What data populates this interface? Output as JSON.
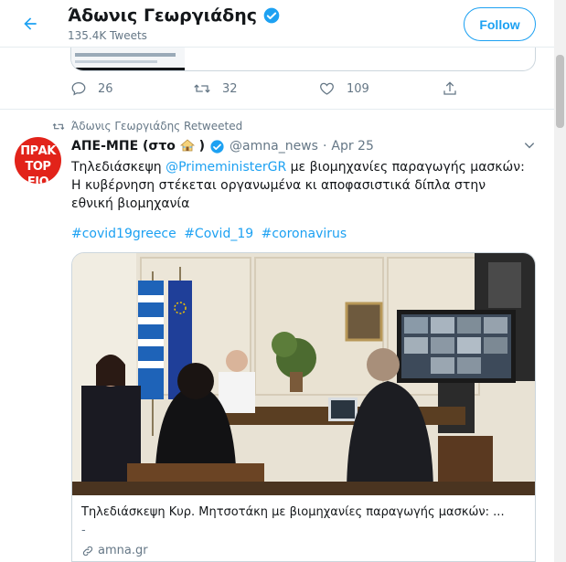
{
  "header": {
    "title": "Άδωνις Γεωργιάδης",
    "tweets_count": "135.4K Tweets",
    "follow_label": "Follow"
  },
  "previous_tweet": {
    "replies": "26",
    "retweets": "32",
    "likes": "109"
  },
  "tweet": {
    "retweeted_by": "Άδωνις Γεωργιάδης Retweeted",
    "avatar_text": "ΠΡΑΚΤΟΡΕΙΟ",
    "name_prefix": "ΑΠΕ-ΜΠΕ (στο",
    "name_suffix": ")",
    "handle": "@amna_news",
    "separator": "·",
    "date": "Apr 25",
    "text_before": "Τηλεδιάσκεψη ",
    "mention": "@PrimeministerGR",
    "text_after": " με βιομηχανίες παραγωγής μασκών: Η κυβέρνηση στέκεται οργανωμένα κι αποφασιστικά δίπλα στην εθνική βιομηχανία",
    "hashtags": [
      "#covid19greece",
      "#Covid_19",
      "#coronavirus"
    ]
  },
  "link_card": {
    "title": "Τηλεδιάσκεψη Κυρ. Μητσοτάκη με βιομηχανίες παραγωγής μασκών: ...",
    "description": "-",
    "domain": "amna.gr"
  },
  "colors": {
    "accent": "#1da1f2",
    "text": "#14171a",
    "muted": "#657786",
    "border": "#e6ecf0",
    "avatar_red": "#e2231a"
  }
}
